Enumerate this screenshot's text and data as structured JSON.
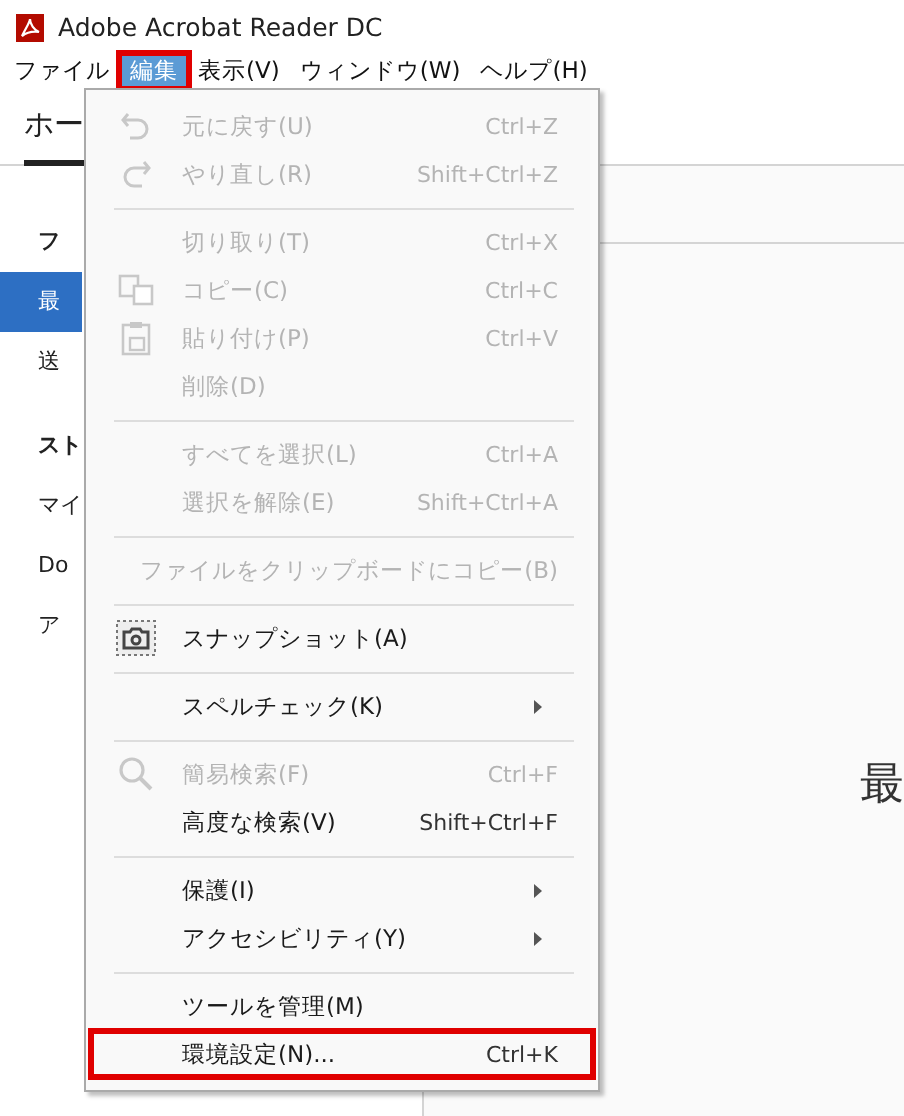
{
  "window": {
    "title": "Adobe Acrobat Reader DC"
  },
  "menubar": [
    {
      "label": "ファイル",
      "selected": false,
      "outlined": false
    },
    {
      "label": "編集",
      "selected": true,
      "outlined": true
    },
    {
      "label": "表示(V)",
      "selected": false,
      "outlined": false
    },
    {
      "label": "ウィンドウ(W)",
      "selected": false,
      "outlined": false
    },
    {
      "label": "ヘルプ(H)",
      "selected": false,
      "outlined": false
    }
  ],
  "tabs": [
    {
      "label": "ホー",
      "selected": true
    }
  ],
  "sidebar": {
    "items": [
      {
        "kind": "heading",
        "label": "フ",
        "selected": false
      },
      {
        "kind": "item",
        "label": "最",
        "selected": true
      },
      {
        "kind": "item",
        "label": "送",
        "selected": false
      },
      {
        "kind": "heading",
        "label": "スト",
        "selected": false
      },
      {
        "kind": "item",
        "label": "マイ",
        "selected": false
      },
      {
        "kind": "item",
        "label": "Do",
        "selected": false
      },
      {
        "kind": "item",
        "label": "ア",
        "selected": false
      }
    ]
  },
  "main": {
    "heading": "最"
  },
  "edit_menu": {
    "items": [
      {
        "kind": "item",
        "label": "元に戻す(U)",
        "shortcut": "Ctrl+Z",
        "disabled": true,
        "submenu": false,
        "outlined": false
      },
      {
        "kind": "item",
        "label": "やり直し(R)",
        "shortcut": "Shift+Ctrl+Z",
        "disabled": true,
        "submenu": false,
        "outlined": false
      },
      {
        "kind": "separator"
      },
      {
        "kind": "item",
        "label": "切り取り(T)",
        "shortcut": "Ctrl+X",
        "disabled": true,
        "submenu": false,
        "outlined": false
      },
      {
        "kind": "item",
        "label": "コピー(C)",
        "shortcut": "Ctrl+C",
        "disabled": true,
        "submenu": false,
        "outlined": false
      },
      {
        "kind": "item",
        "label": "貼り付け(P)",
        "shortcut": "Ctrl+V",
        "disabled": true,
        "submenu": false,
        "outlined": false
      },
      {
        "kind": "item",
        "label": "削除(D)",
        "disabled": true,
        "submenu": false,
        "outlined": false
      },
      {
        "kind": "separator"
      },
      {
        "kind": "item",
        "label": "すべてを選択(L)",
        "shortcut": "Ctrl+A",
        "disabled": true,
        "submenu": false,
        "outlined": false
      },
      {
        "kind": "item",
        "label": "選択を解除(E)",
        "shortcut": "Shift+Ctrl+A",
        "disabled": true,
        "submenu": false,
        "outlined": false
      },
      {
        "kind": "separator"
      },
      {
        "kind": "item",
        "label": "ファイルをクリップボードにコピー(B)",
        "disabled": true,
        "submenu": false,
        "outlined": false
      },
      {
        "kind": "separator"
      },
      {
        "kind": "item",
        "label": "スナップショット(A)",
        "disabled": false,
        "submenu": false,
        "outlined": false
      },
      {
        "kind": "separator"
      },
      {
        "kind": "item",
        "label": "スペルチェック(K)",
        "disabled": false,
        "submenu": true,
        "outlined": false
      },
      {
        "kind": "separator"
      },
      {
        "kind": "item",
        "label": "簡易検索(F)",
        "shortcut": "Ctrl+F",
        "disabled": true,
        "submenu": false,
        "outlined": false
      },
      {
        "kind": "item",
        "label": "高度な検索(V)",
        "shortcut": "Shift+Ctrl+F",
        "disabled": false,
        "submenu": false,
        "outlined": false
      },
      {
        "kind": "separator"
      },
      {
        "kind": "item",
        "label": "保護(I)",
        "disabled": false,
        "submenu": true,
        "outlined": false
      },
      {
        "kind": "item",
        "label": "アクセシビリティ(Y)",
        "disabled": false,
        "submenu": true,
        "outlined": false
      },
      {
        "kind": "separator"
      },
      {
        "kind": "item",
        "label": "ツールを管理(M)",
        "disabled": false,
        "submenu": false,
        "outlined": false
      },
      {
        "kind": "item",
        "label": "環境設定(N)...",
        "shortcut": "Ctrl+K",
        "disabled": false,
        "submenu": false,
        "outlined": true
      }
    ]
  }
}
